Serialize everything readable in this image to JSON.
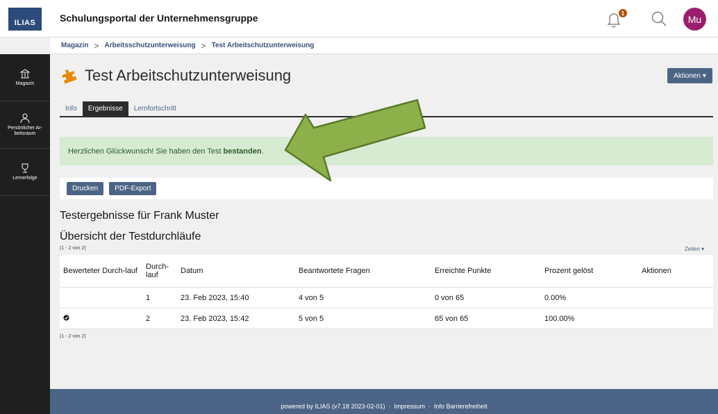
{
  "header": {
    "logo": "ILIAS",
    "portal_title": "Schulungsportal der Unternehmensgruppe",
    "notification_count": "1",
    "avatar_initials": "Mu"
  },
  "breadcrumb": [
    "Magazin",
    "Arbeitsschutzunterweisung",
    "Test Arbeitschutzunterweisung"
  ],
  "leftbar": [
    {
      "label": "Magazin",
      "icon": "repository-icon"
    },
    {
      "label": "Persönlicher Ar-beitsraum",
      "icon": "person-icon"
    },
    {
      "label": "Lernerfolge",
      "icon": "trophy-icon"
    }
  ],
  "page": {
    "title": "Test Arbeitschutzunterweisung",
    "actions_label": "Aktionen ▾",
    "tabs": [
      "Info",
      "Ergebnisse",
      "Lernfortschritt"
    ],
    "active_tab": "Ergebnisse",
    "success_text": "Herzlichen Glückwunsch! Sie haben den Test",
    "success_bold": "bestanden",
    "success_end": ".",
    "buttons": [
      "Drucken",
      "PDF-Export"
    ],
    "result_title": "Testergebnisse für Frank Muster",
    "overview_title": "Übersicht der Testdurchläufe",
    "count_label": "(1 - 2 von 2)",
    "rows_label": "Zeilen ▾"
  },
  "table": {
    "headers": [
      "Bewerteter Durch-lauf",
      "Durch-lauf",
      "Datum",
      "Beantwortete Fragen",
      "Erreichte Punkte",
      "Prozent gelöst",
      "Aktionen"
    ],
    "rows": [
      {
        "rated": "",
        "run": "1",
        "date": "23. Feb 2023, 15:40",
        "answered": "4 von 5",
        "points": "0 von 65",
        "percent": "0.00%",
        "actions": ""
      },
      {
        "rated": "✓",
        "run": "2",
        "date": "23. Feb 2023, 15:42",
        "answered": "5 von 5",
        "points": "65 von 65",
        "percent": "100.00%",
        "actions": ""
      }
    ]
  },
  "footer": {
    "powered": "powered by ILIAS (v7.18 2023-02-01)",
    "impressum": "Impressum",
    "accessibility": "Info Barrierefreiheit"
  },
  "colors": {
    "primary": "#4c6586",
    "success_bg": "#d7ead2",
    "arrow": "#8db04a",
    "arrow_border": "#5a7a2a",
    "test_icon": "#e78a00"
  }
}
